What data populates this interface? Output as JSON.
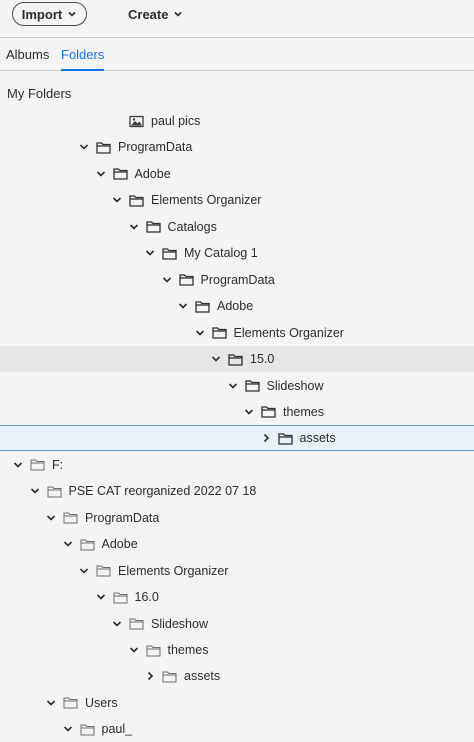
{
  "toolbar": {
    "import_label": "Import",
    "create_label": "Create"
  },
  "tabs": [
    {
      "label": "Albums",
      "active": false
    },
    {
      "label": "Folders",
      "active": true
    }
  ],
  "section_title": "My Folders",
  "tree": [
    {
      "label": "paul pics",
      "level": 6,
      "toggle": "none",
      "icon": "image-folder-icon"
    },
    {
      "label": "ProgramData",
      "level": 4,
      "toggle": "expanded",
      "icon": "folder-icon"
    },
    {
      "label": "Adobe",
      "level": 5,
      "toggle": "expanded",
      "icon": "folder-icon"
    },
    {
      "label": "Elements Organizer",
      "level": 6,
      "toggle": "expanded",
      "icon": "folder-icon"
    },
    {
      "label": "Catalogs",
      "level": 7,
      "toggle": "expanded",
      "icon": "folder-icon"
    },
    {
      "label": "My Catalog 1",
      "level": 8,
      "toggle": "expanded",
      "icon": "folder-icon"
    },
    {
      "label": "ProgramData",
      "level": 9,
      "toggle": "expanded",
      "icon": "folder-icon"
    },
    {
      "label": "Adobe",
      "level": 10,
      "toggle": "expanded",
      "icon": "folder-icon"
    },
    {
      "label": "Elements Organizer",
      "level": 11,
      "toggle": "expanded",
      "icon": "folder-icon"
    },
    {
      "label": "15.0",
      "level": 12,
      "toggle": "expanded",
      "icon": "folder-icon",
      "state": "hover"
    },
    {
      "label": "Slideshow",
      "level": 13,
      "toggle": "expanded",
      "icon": "folder-icon"
    },
    {
      "label": "themes",
      "level": 14,
      "toggle": "expanded",
      "icon": "folder-icon"
    },
    {
      "label": "assets",
      "level": 15,
      "toggle": "collapsed",
      "icon": "folder-icon",
      "state": "selected"
    },
    {
      "label": "F:",
      "level": 0,
      "toggle": "expanded",
      "icon": "folder-outline-icon"
    },
    {
      "label": "PSE CAT reorganized 2022 07 18",
      "level": 1,
      "toggle": "expanded",
      "icon": "folder-outline-icon"
    },
    {
      "label": "ProgramData",
      "level": 2,
      "toggle": "expanded",
      "icon": "folder-outline-icon"
    },
    {
      "label": "Adobe",
      "level": 3,
      "toggle": "expanded",
      "icon": "folder-outline-icon"
    },
    {
      "label": "Elements Organizer",
      "level": 4,
      "toggle": "expanded",
      "icon": "folder-outline-icon"
    },
    {
      "label": "16.0",
      "level": 5,
      "toggle": "expanded",
      "icon": "folder-outline-icon"
    },
    {
      "label": "Slideshow",
      "level": 6,
      "toggle": "expanded",
      "icon": "folder-outline-icon"
    },
    {
      "label": "themes",
      "level": 7,
      "toggle": "expanded",
      "icon": "folder-outline-icon"
    },
    {
      "label": "assets",
      "level": 8,
      "toggle": "collapsed",
      "icon": "folder-outline-icon"
    },
    {
      "label": "Users",
      "level": 2,
      "toggle": "expanded",
      "icon": "folder-outline-icon"
    },
    {
      "label": "paul_",
      "level": 3,
      "toggle": "expanded",
      "icon": "folder-outline-icon"
    }
  ]
}
